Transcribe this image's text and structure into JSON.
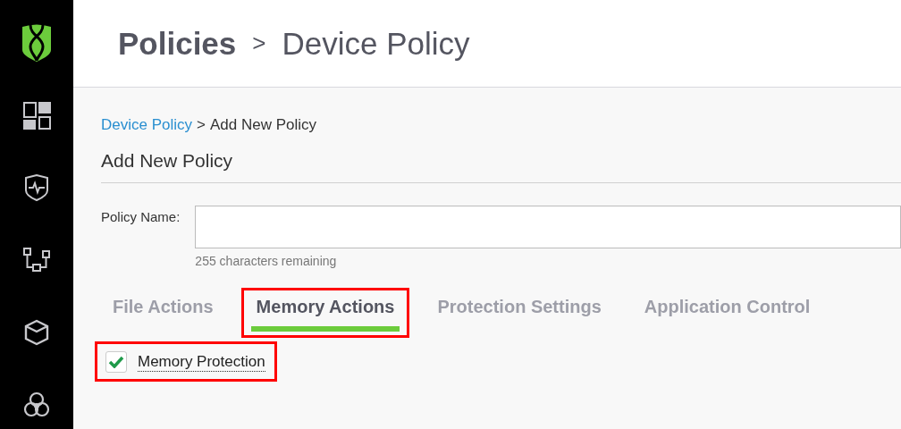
{
  "sidebar": {
    "items": [
      {
        "kind": "logo",
        "selected": false
      },
      {
        "kind": "dashboard",
        "selected": false
      },
      {
        "kind": "protection",
        "selected": false
      },
      {
        "kind": "network",
        "selected": false
      },
      {
        "kind": "package",
        "selected": false
      },
      {
        "kind": "integrations",
        "selected": false
      }
    ]
  },
  "header": {
    "title": "Policies",
    "separator": ">",
    "subtitle": "Device Policy"
  },
  "breadcrumb": {
    "link": "Device Policy",
    "separator": ">",
    "current": "Add New Policy"
  },
  "page_title": "Add New Policy",
  "policy_name": {
    "label": "Policy Name:",
    "hint": "255 characters remaining"
  },
  "tabs": [
    {
      "label": "File Actions",
      "selected": false,
      "highlighted": false
    },
    {
      "label": "Memory Actions",
      "selected": true,
      "highlighted": true
    },
    {
      "label": "Protection Settings",
      "selected": false,
      "highlighted": false
    },
    {
      "label": "Application Control",
      "selected": false,
      "highlighted": false
    }
  ],
  "options": [
    {
      "label": "Memory Protection",
      "checked": true,
      "highlighted": true
    }
  ]
}
